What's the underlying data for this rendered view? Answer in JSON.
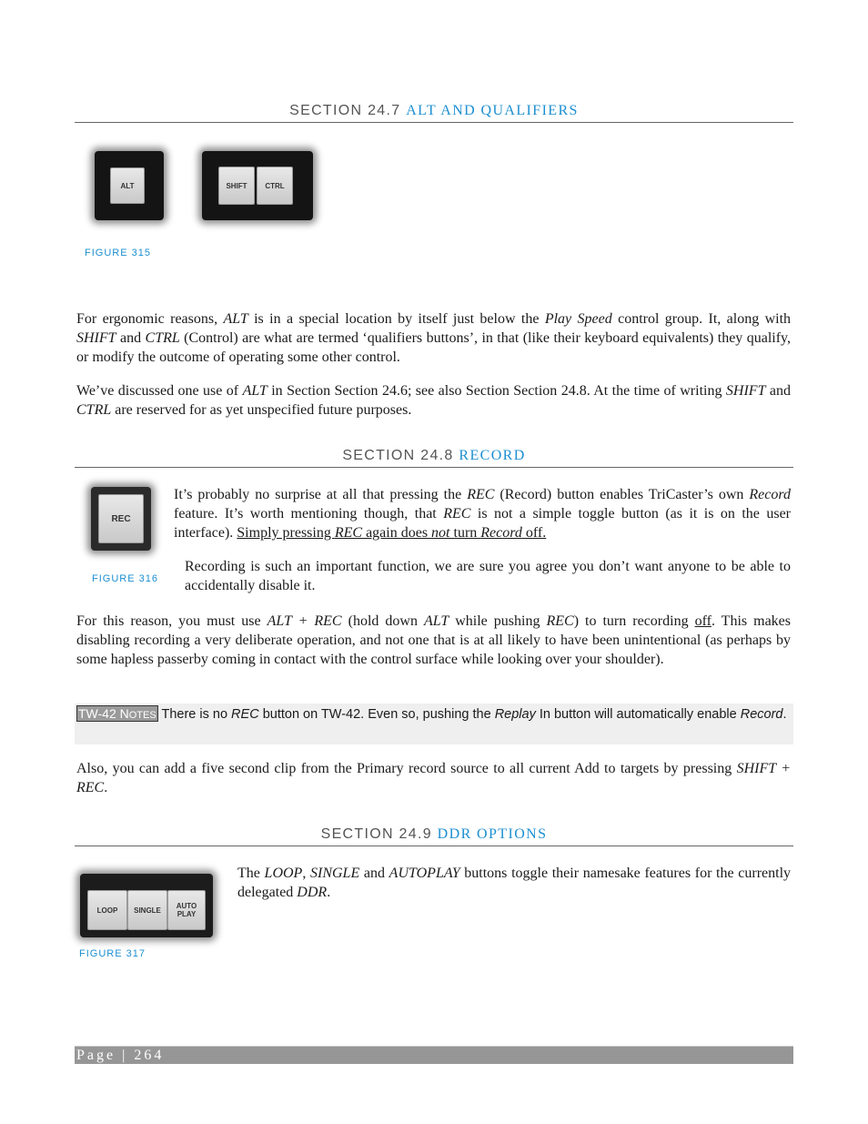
{
  "sections": [
    {
      "prefix": "SECTION 24.7",
      "title": "ALT AND QUALIFIERS"
    },
    {
      "prefix": "SECTION 24.8",
      "title": "RECORD"
    },
    {
      "prefix": "SECTION 24.9",
      "title": "DDR OPTIONS"
    }
  ],
  "figures": {
    "f315": {
      "caption": "FIGURE 315",
      "keys": [
        "ALT",
        "SHIFT",
        "CTRL"
      ]
    },
    "f316": {
      "caption": "FIGURE 316",
      "keys": [
        "REC"
      ]
    },
    "f317": {
      "caption": "FIGURE 317",
      "keys": [
        "LOOP",
        "SINGLE",
        "AUTO PLAY"
      ]
    }
  },
  "s247": {
    "p1": {
      "a": "For ergonomic reasons, ",
      "alt": "ALT",
      "b": " is in a special location by itself just below the ",
      "playspeed": "Play Speed",
      "c": " control group.  It, along with ",
      "shift": "SHIFT",
      "d": " and ",
      "ctrl": "CTRL",
      "e": " (Control) are what are termed ‘qualifiers buttons’, in that (like their keyboard equivalents) they qualify, or modify the outcome of operating some other control."
    },
    "p2": {
      "a": "We’ve discussed one use of ",
      "alt": "ALT",
      "b": " in Section Section 24.6; see also Section Section 24.8.  At the time of writing ",
      "shift": "SHIFT",
      "c": " and ",
      "ctrl": "CTRL",
      "d": " are reserved for as yet unspecified future purposes."
    }
  },
  "s248": {
    "p1": {
      "a": "It’s probably no surprise at all that pressing the ",
      "rec": "REC",
      "b": " (Record) button enables TriCaster’s own ",
      "record": "Record",
      "c": " feature. It’s worth mentioning though, that ",
      "rec2": "REC",
      "d": " is not a simple toggle button (as it is on the user interface).  ",
      "u1": "Simply pressing ",
      "urec": "REC",
      "u2": " again does ",
      "unot": "not",
      "u3": " turn ",
      "urecord": "Record",
      "u4": " off."
    },
    "p2": "Recording is such an important function, we are sure you agree you don’t want anyone to be able to accidentally disable it.",
    "p3": {
      "a": "For this reason, you must use ",
      "altrec": "ALT + REC",
      "b": " (hold down ",
      "alt": "ALT",
      "c": " while pushing ",
      "rec": "REC",
      "d": ") to turn recording ",
      "off": "off",
      "e": ".  This makes disabling recording a very deliberate operation, and not one that is at all likely to have been unintentional (as perhaps by some hapless passerby coming in contact with the control surface while looking over your shoulder)."
    },
    "note": {
      "tag_a": "TW-42 N",
      "tag_b": "OTES",
      "a": " There is no ",
      "rec": "REC",
      "b": " button on TW-42.  Even so, pushing the ",
      "replay": "Replay",
      "c": " In button will automatically enable ",
      "record": "Record",
      "d": "."
    },
    "p4": {
      "a": "Also, you can add a five second clip from the Primary record source to all current Add to targets by pressing ",
      "shiftrec": "SHIFT + REC",
      "b": "."
    }
  },
  "s249": {
    "p1": {
      "a": "The ",
      "loop": "LOOP",
      "b": ", ",
      "single": "SINGLE",
      "c": " and ",
      "autoplay": "AUTOPLAY",
      "d": " buttons toggle their namesake features for the currently delegated ",
      "ddr": "DDR",
      "e": "."
    }
  },
  "footer": {
    "label": "Page",
    "sep": " | ",
    "page_number": "264"
  }
}
